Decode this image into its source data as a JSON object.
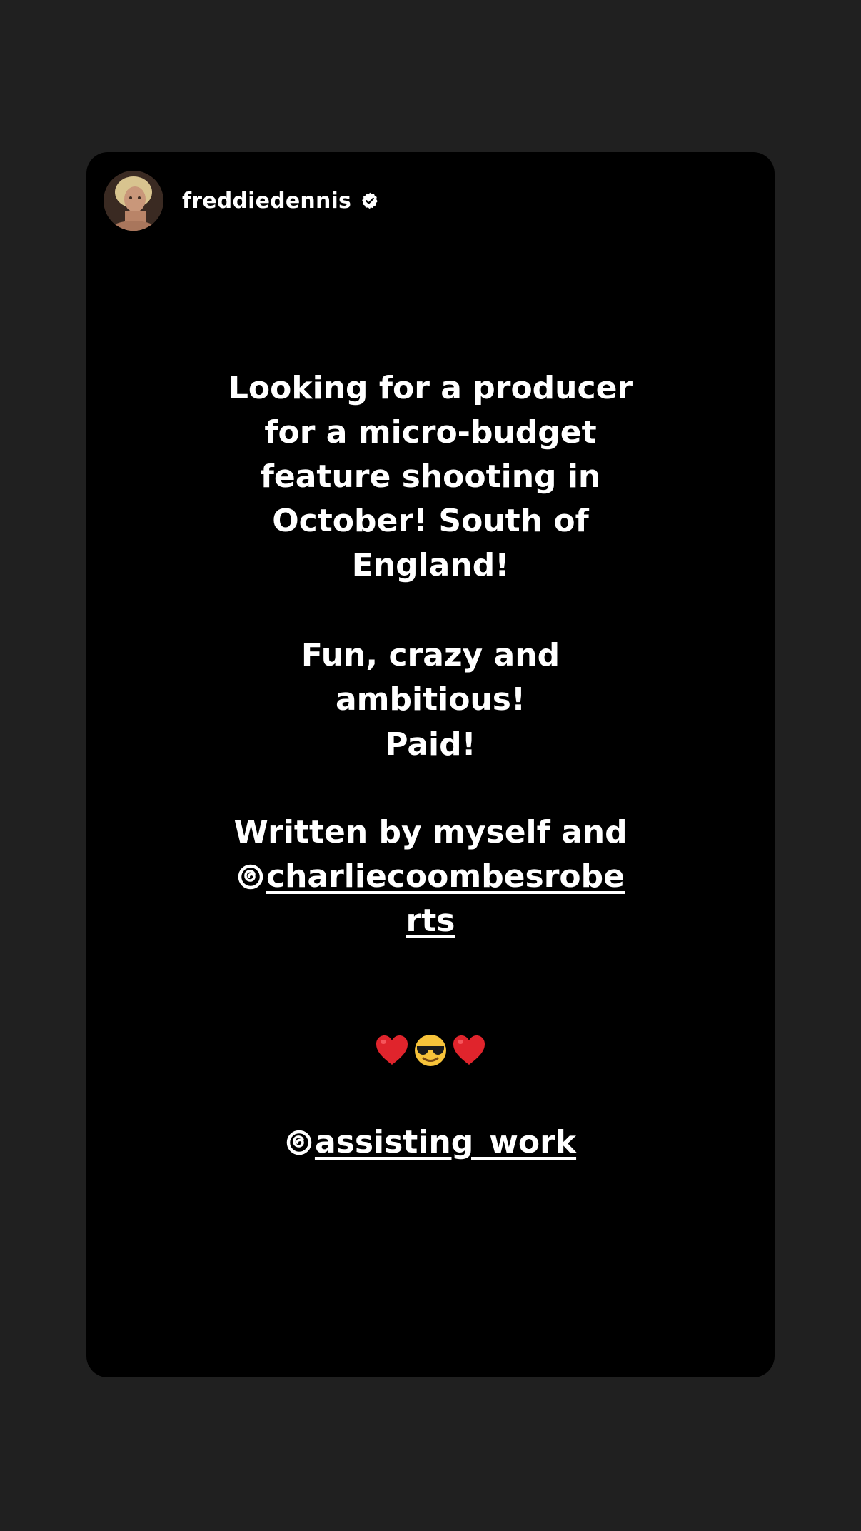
{
  "story": {
    "username": "freddiedennis",
    "verified": true,
    "avatar_icon": "profile-photo",
    "text": {
      "para1": [
        "Looking for a producer",
        "for a micro-budget",
        "feature shooting in",
        "October! South of",
        "England!"
      ],
      "para2": [
        "Fun, crazy and",
        "ambitious!"
      ],
      "para3": "Paid!",
      "para4_line": "Written by myself and",
      "mention1_part1": "charliecoombesrobe",
      "mention1_part2": "rts",
      "emojis": [
        "heart-icon",
        "sunglasses-face-icon",
        "heart-icon"
      ],
      "mention2": "assisting_work"
    },
    "colors": {
      "background": "#202020",
      "card": "#000000",
      "text": "#ffffff",
      "heart": "#e0242c",
      "face": "#f7c33a"
    }
  }
}
